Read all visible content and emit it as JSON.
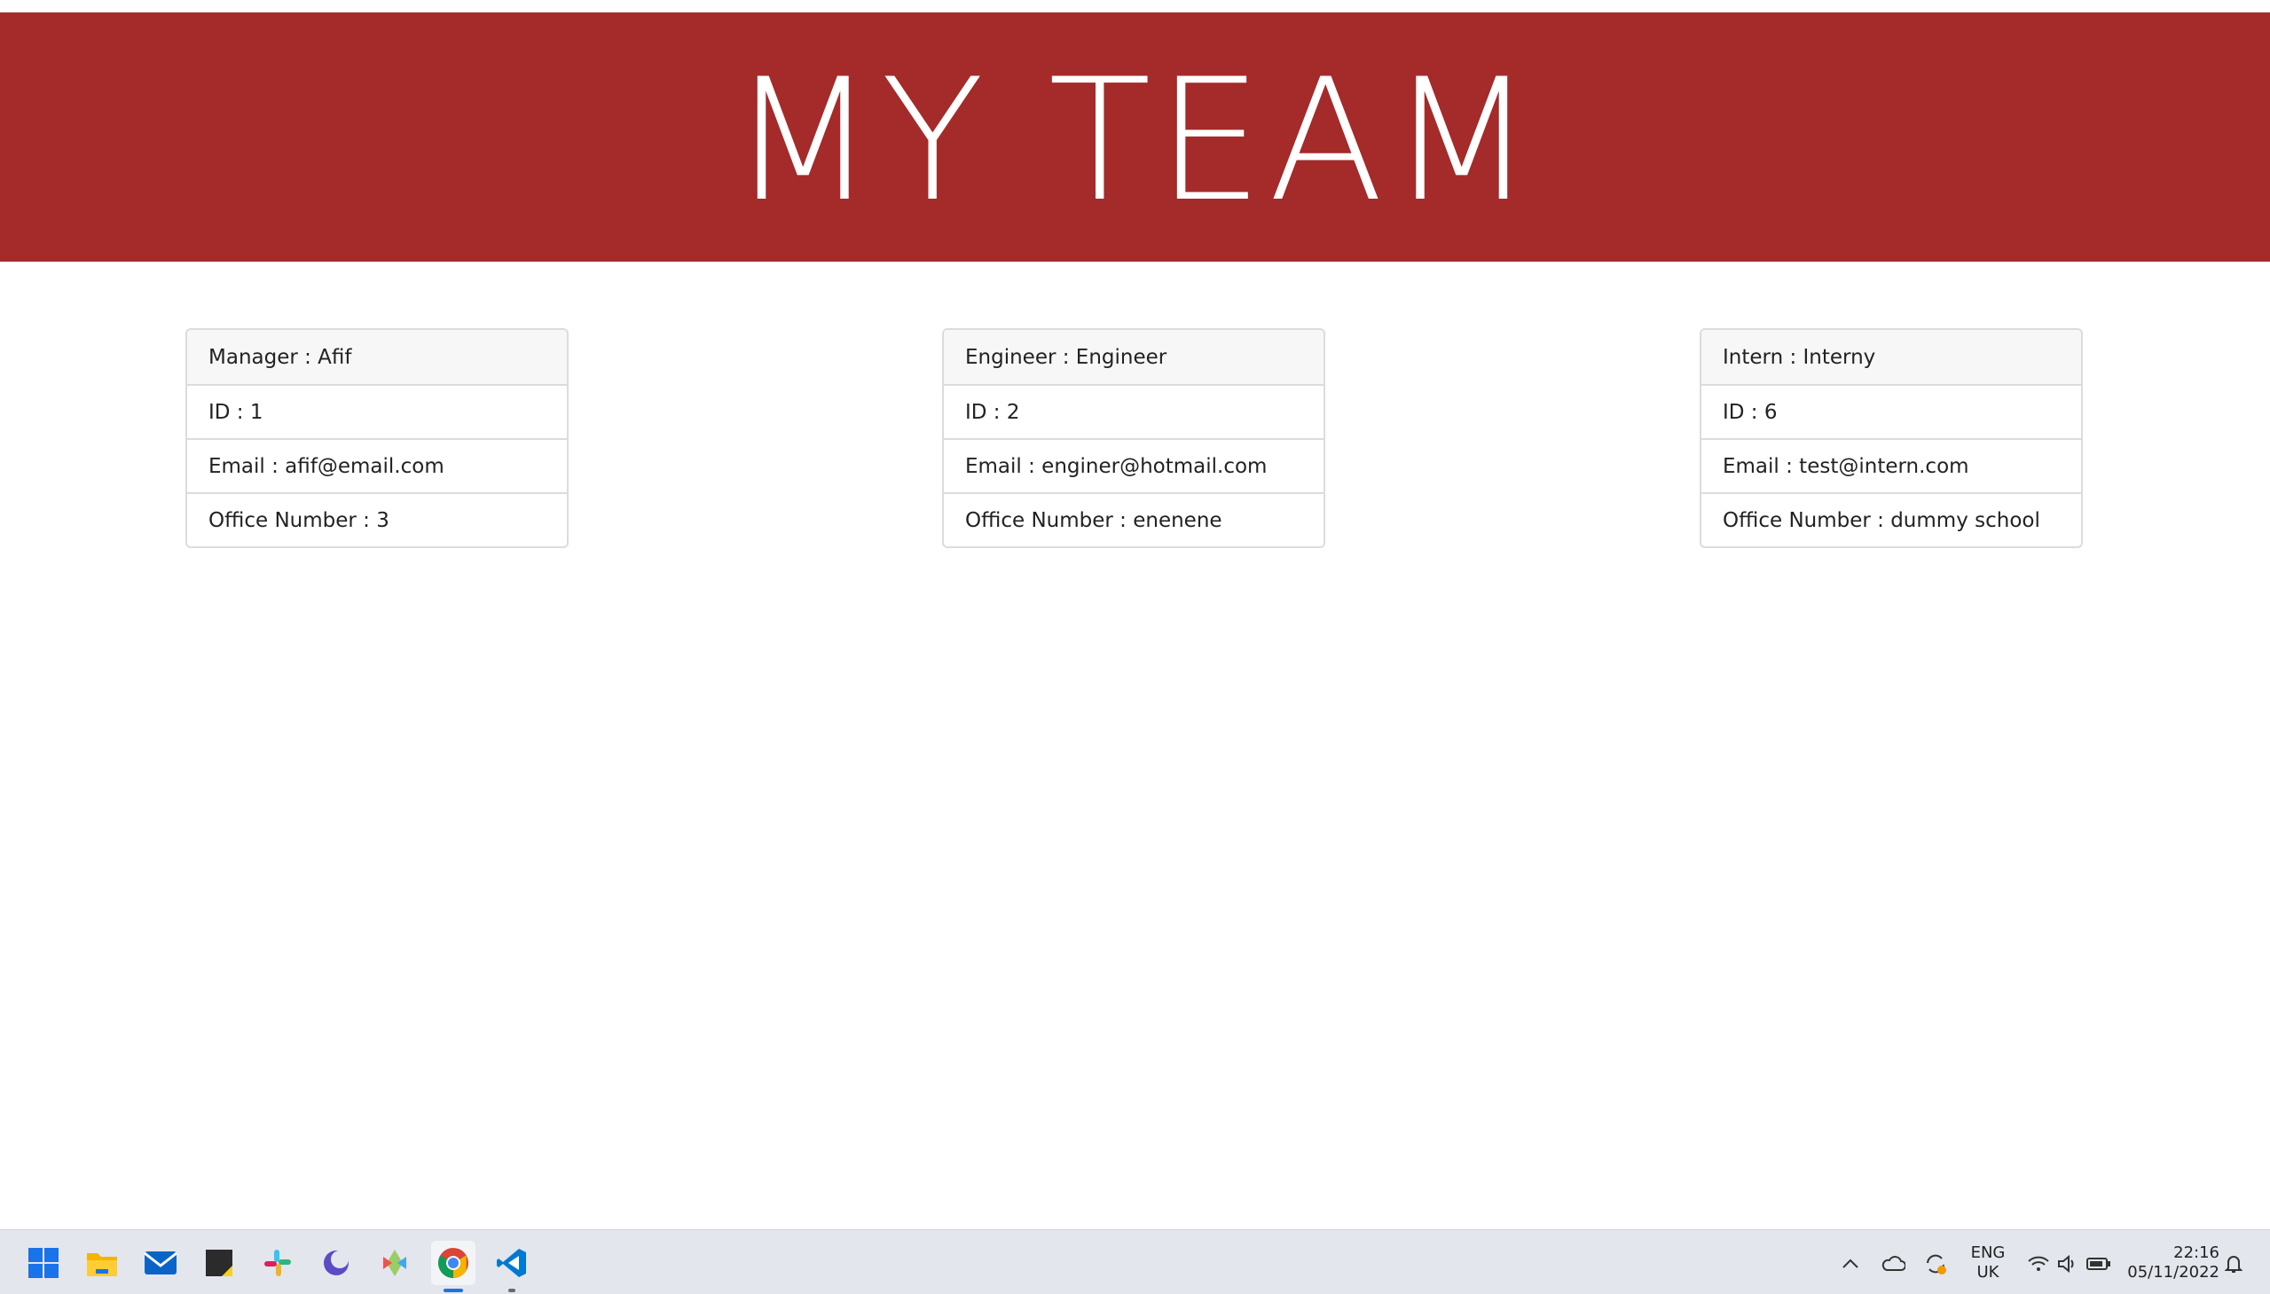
{
  "header": {
    "title": "MY TEAM",
    "background": "#a52a2a"
  },
  "cards": [
    {
      "title": "Manager : Afif",
      "id": "ID : 1",
      "email": "Email : afif@email.com",
      "extra": "Office Number : 3"
    },
    {
      "title": "Engineer : Engineer",
      "id": "ID : 2",
      "email": "Email : enginer@hotmail.com",
      "extra": "Office Number : enenene"
    },
    {
      "title": "Intern : Interny",
      "id": "ID : 6",
      "email": "Email : test@intern.com",
      "extra": "Office Number : dummy school"
    }
  ],
  "taskbar": {
    "apps": [
      "windows-start-icon",
      "file-explorer-icon",
      "mail-icon",
      "sticky-notes-icon",
      "slack-icon",
      "app-moon-icon",
      "gitkraken-icon",
      "chrome-icon",
      "vscode-icon"
    ],
    "language_line1": "ENG",
    "language_line2": "UK",
    "time": "22:16",
    "date": "05/11/2022"
  }
}
